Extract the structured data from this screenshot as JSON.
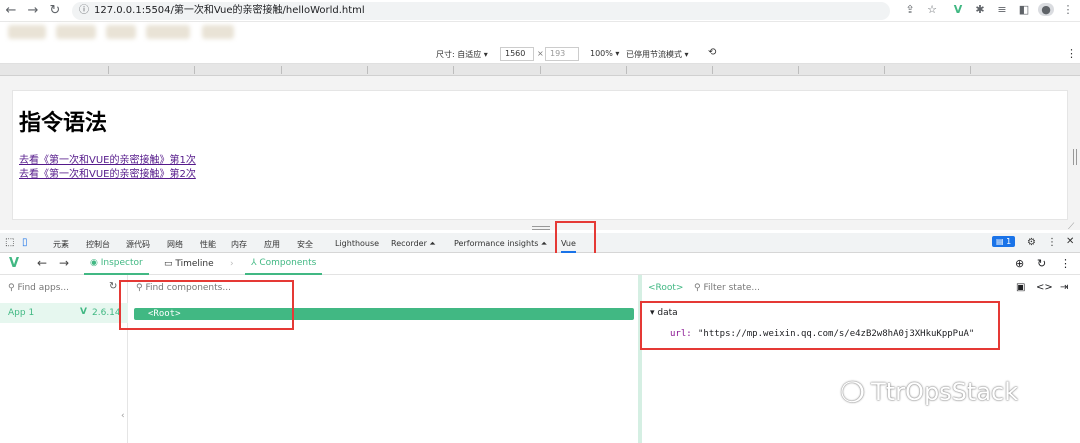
{
  "browser": {
    "url_prefix": "127.0.0.1:5504/第一次和Vue的亲密接触/helloWorld.html"
  },
  "device_toolbar": {
    "dimension_label": "尺寸: 自适应 ▾",
    "width": "1560",
    "separator": "×",
    "height": "193",
    "zoom": "100% ▾",
    "throttling": "已停用节流模式 ▾"
  },
  "page": {
    "heading": "指令语法",
    "links": [
      "去看《第一次和VUE的亲密接触》第1次",
      "去看《第一次和VUE的亲密接触》第2次"
    ]
  },
  "devtools": {
    "tabs": [
      "元素",
      "控制台",
      "源代码",
      "网络",
      "性能",
      "内存",
      "应用",
      "安全",
      "Lighthouse",
      "Recorder ⏶",
      "Performance insights ⏶",
      "Vue"
    ],
    "issues_badge": "1"
  },
  "vue_devtools": {
    "nav": {
      "inspector": "Inspector",
      "timeline": "Timeline",
      "components": "Components"
    },
    "apps": {
      "search_placeholder": "Find apps...",
      "app_name": "App 1",
      "version": "2.6.14"
    },
    "components": {
      "search_placeholder": "Find components...",
      "root": "<Root>"
    },
    "state": {
      "selected": "<Root>",
      "filter_placeholder": "Filter state...",
      "section": "data",
      "key": "url:",
      "value": "\"https://mp.weixin.qq.com/s/e4zB2w8hA0j3XHkuKppPuA\""
    }
  },
  "watermark": "TtrOpsStack",
  "colors": {
    "vue_green": "#41b883",
    "highlight_red": "#e53935"
  }
}
